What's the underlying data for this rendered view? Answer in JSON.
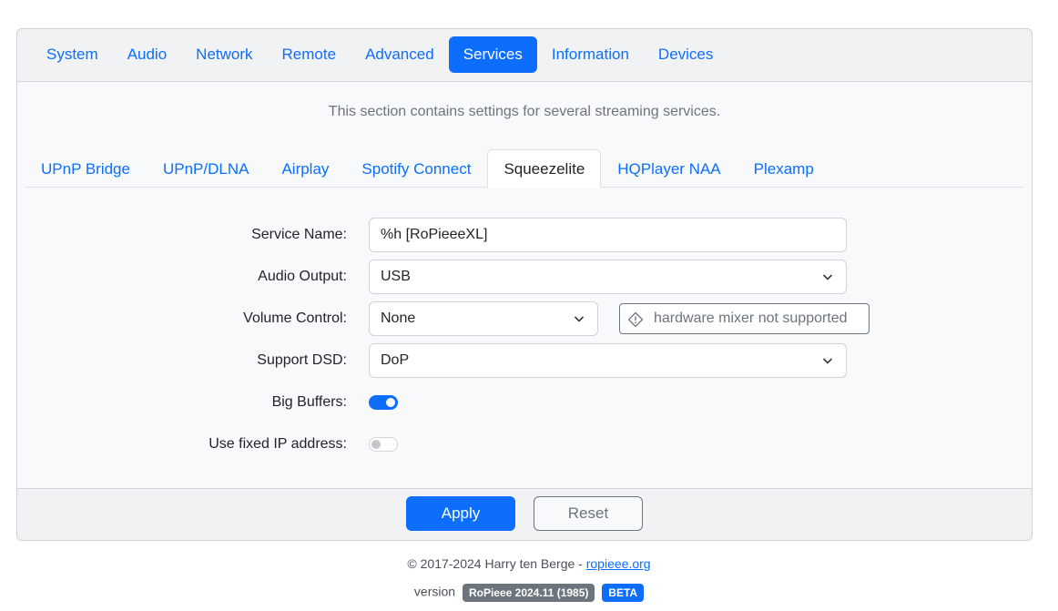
{
  "main_tabs": [
    "System",
    "Audio",
    "Network",
    "Remote",
    "Advanced",
    "Services",
    "Information",
    "Devices"
  ],
  "active_main_tab": "Services",
  "section_description": "This section contains settings for several streaming services.",
  "sub_tabs": [
    "UPnP Bridge",
    "UPnP/DLNA",
    "Airplay",
    "Spotify Connect",
    "Squeezelite",
    "HQPlayer NAA",
    "Plexamp"
  ],
  "active_sub_tab": "Squeezelite",
  "form": {
    "service_name": {
      "label": "Service Name:",
      "value": "%h [RoPieeeXL]"
    },
    "audio_output": {
      "label": "Audio Output:",
      "value": "USB"
    },
    "volume_control": {
      "label": "Volume Control:",
      "value": "None",
      "hint": "hardware mixer not supported"
    },
    "support_dsd": {
      "label": "Support DSD:",
      "value": "DoP"
    },
    "big_buffers": {
      "label": "Big Buffers:",
      "enabled": true
    },
    "fixed_ip": {
      "label": "Use fixed IP address:",
      "enabled": false
    }
  },
  "footer": {
    "apply_label": "Apply",
    "reset_label": "Reset"
  },
  "copyright": {
    "text": "© 2017-2024 Harry ten Berge - ",
    "link": "ropieee.org"
  },
  "version": {
    "label": "version",
    "build": "RoPieee 2024.11 (1985)",
    "channel": "BETA"
  },
  "colors": {
    "accent": "#0d6efd",
    "muted": "#6c757d",
    "header_bg": "#f1f2f3"
  }
}
